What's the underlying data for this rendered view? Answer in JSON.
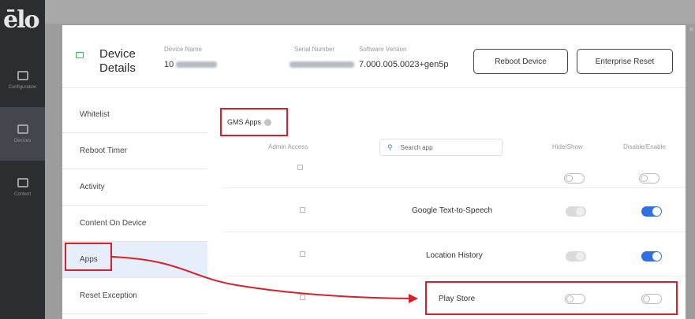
{
  "app": {
    "logo": "ēlo",
    "rail": [
      {
        "label": "Configuration"
      },
      {
        "label": "Devices"
      },
      {
        "label": "Content"
      }
    ]
  },
  "header": {
    "title_line1": "Device",
    "title_line2": "Details",
    "device_name_label": "Device Name",
    "device_name_prefix": "10",
    "serial_label": "Serial Number",
    "software_label": "Software Version",
    "software_value": "7.000.005.0023+gen5p",
    "reboot_label": "Reboot Device",
    "reset_label": "Enterprise Reset",
    "close": "×"
  },
  "nav": {
    "items": [
      {
        "label": "Whitelist"
      },
      {
        "label": "Reboot Timer"
      },
      {
        "label": "Activity"
      },
      {
        "label": "Content On Device"
      },
      {
        "label": "Apps"
      },
      {
        "label": "Reset Exception"
      }
    ]
  },
  "main": {
    "section_label": "GMS Apps",
    "col_admin": "Admin Access",
    "search_placeholder": "Search app",
    "col_hide": "Hide/Show",
    "col_disable": "Disable/Enable",
    "rows": [
      {
        "name": "",
        "hide": "off",
        "disable": "off"
      },
      {
        "name": "Google Text-to-Speech",
        "hide": "grey",
        "disable": "on"
      },
      {
        "name": "Location History",
        "hide": "grey",
        "disable": "on"
      },
      {
        "name": "Play Store",
        "hide": "off",
        "disable": "off"
      }
    ]
  },
  "colors": {
    "accent_blue": "#2f6fe0",
    "annotation_red": "#d6202a",
    "status_green": "#2ebd59"
  }
}
